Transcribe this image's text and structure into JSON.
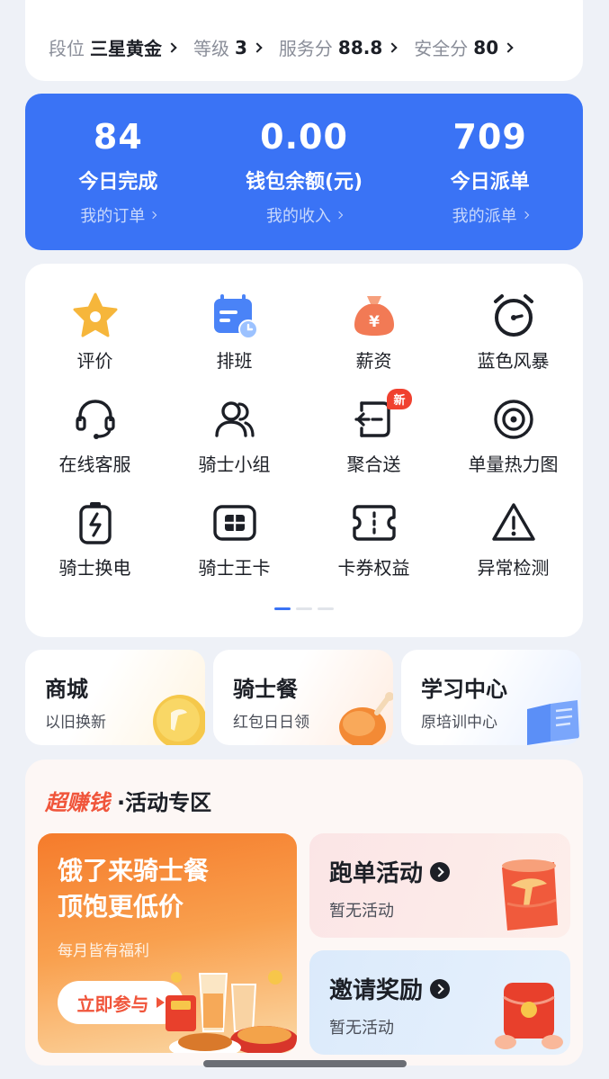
{
  "rank": [
    {
      "label": "段位",
      "value": "三星黄金"
    },
    {
      "label": "等级",
      "value": "3"
    },
    {
      "label": "服务分",
      "value": "88.8"
    },
    {
      "label": "安全分",
      "value": "80"
    }
  ],
  "stats": [
    {
      "value": "84",
      "label": "今日完成",
      "link": "我的订单"
    },
    {
      "value": "0.00",
      "label": "钱包余额(元)",
      "link": "我的收入"
    },
    {
      "value": "709",
      "label": "今日派单",
      "link": "我的派单"
    }
  ],
  "grid": [
    {
      "label": "评价",
      "icon": "star-icon"
    },
    {
      "label": "排班",
      "icon": "calendar-icon"
    },
    {
      "label": "薪资",
      "icon": "money-bag-icon"
    },
    {
      "label": "蓝色风暴",
      "icon": "alarm-clock-icon"
    },
    {
      "label": "在线客服",
      "icon": "headset-icon"
    },
    {
      "label": "骑士小组",
      "icon": "group-icon"
    },
    {
      "label": "聚合送",
      "icon": "aggregate-icon",
      "badge": "新"
    },
    {
      "label": "单量热力图",
      "icon": "target-icon"
    },
    {
      "label": "骑士换电",
      "icon": "battery-icon"
    },
    {
      "label": "骑士王卡",
      "icon": "sim-card-icon"
    },
    {
      "label": "卡券权益",
      "icon": "coupon-icon"
    },
    {
      "label": "异常检测",
      "icon": "warning-icon"
    }
  ],
  "pager": {
    "pages": 3,
    "active": 0
  },
  "quick": [
    {
      "title": "商城",
      "sub": "以旧换新",
      "icon": "coin-icon"
    },
    {
      "title": "骑士餐",
      "sub": "红包日日领",
      "icon": "chicken-icon"
    },
    {
      "title": "学习中心",
      "sub": "原培训中心",
      "icon": "book-icon"
    }
  ],
  "activity": {
    "brand": "超赚钱",
    "title": "·活动专区",
    "promo": {
      "title_line1": "饿了来骑士餐",
      "title_line2": "顶饱更低价",
      "sub": "每月皆有福利",
      "button": "立即参与"
    },
    "run": {
      "title": "跑单活动",
      "sub": "暂无活动"
    },
    "invite": {
      "title": "邀请奖励",
      "sub": "暂无活动"
    }
  },
  "colors": {
    "accent": "#3a73f5",
    "badge": "#f0412f",
    "brand": "#f0553b"
  }
}
